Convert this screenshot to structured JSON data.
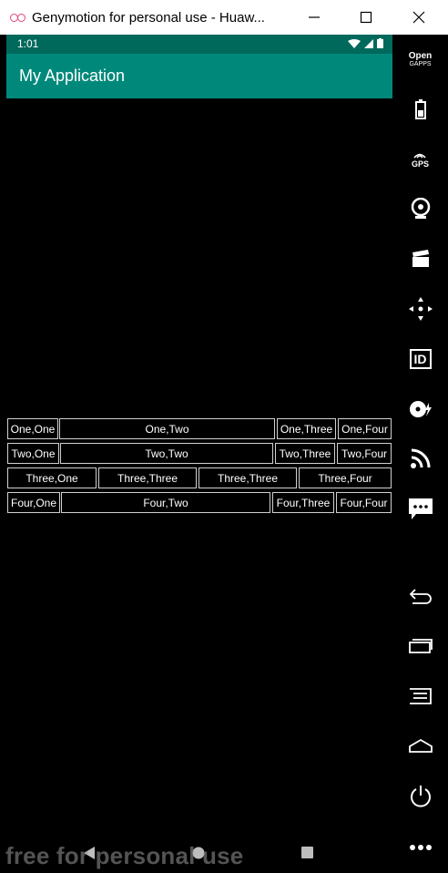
{
  "window": {
    "title": "Genymotion for personal use - Huaw...",
    "minimize_label": "—",
    "maximize_label": "☐",
    "close_label": "✕"
  },
  "statusbar": {
    "time": "1:01"
  },
  "appbar": {
    "title": "My Application"
  },
  "table": {
    "rows": [
      [
        "One,One",
        "One,Two",
        "One,Three",
        "One,Four"
      ],
      [
        "Two,One",
        "Two,Two",
        "Two,Three",
        "Two,Four"
      ],
      [
        "Three,One",
        "Three,Three",
        "Three,Three",
        "Three,Four"
      ],
      [
        "Four,One",
        "Four,Two",
        "Four,Three",
        "Four,Four"
      ]
    ]
  },
  "toolbar": {
    "opengapps_line1": "Open",
    "opengapps_line2": "GAPPS",
    "gps_label": "GPS",
    "id_label": "ID"
  },
  "watermark": "free for personal use",
  "colors": {
    "statusbar": "#00695c",
    "appbar": "#00897b"
  }
}
